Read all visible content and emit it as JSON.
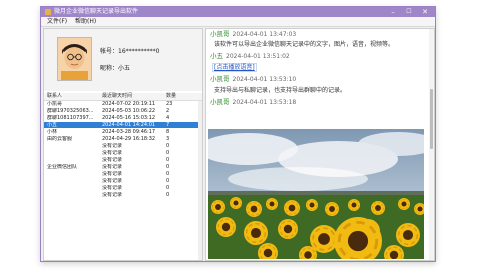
{
  "window": {
    "title": "微月企业微信聊天记录导出软件",
    "controls": {
      "minimize": "–",
      "maximize": "☐",
      "close": "✕"
    }
  },
  "menu": {
    "items": [
      "文件(F)",
      "帮助(H)"
    ]
  },
  "profile": {
    "account_label": "帐号：",
    "account_value": "16**********0",
    "nickname_label": "昵称：",
    "nickname_value": "小五"
  },
  "contacts_table": {
    "columns": [
      "联系人",
      "最近聊天时间",
      "数量"
    ],
    "rows": [
      {
        "name": "小凯哥",
        "time": "2024-07-02 20:19:11",
        "count": "23",
        "selected": false
      },
      {
        "name": "群聊1970325063...",
        "time": "2024-05-03 10:06:22",
        "count": "2",
        "selected": false
      },
      {
        "name": "群聊1081107397...",
        "time": "2024-05-16 15:03:12",
        "count": "4",
        "selected": false
      },
      {
        "name": "小五",
        "time": "2024-04-01 14:24:01",
        "count": "7",
        "selected": true
      },
      {
        "name": "小林",
        "time": "2024-03-28 09:46:17",
        "count": "8",
        "selected": false
      },
      {
        "name": "由的云客服",
        "time": "2024-04-29 16:18:32",
        "count": "3",
        "selected": false
      },
      {
        "name": "",
        "time": "没有记录",
        "count": "0",
        "selected": false
      },
      {
        "name": "",
        "time": "没有记录",
        "count": "0",
        "selected": false
      },
      {
        "name": "",
        "time": "没有记录",
        "count": "0",
        "selected": false
      },
      {
        "name": "企业微信团队",
        "time": "没有记录",
        "count": "0",
        "selected": false
      },
      {
        "name": "",
        "time": "没有记录",
        "count": "0",
        "selected": false
      },
      {
        "name": "",
        "time": "没有记录",
        "count": "0",
        "selected": false
      },
      {
        "name": "",
        "time": "没有记录",
        "count": "0",
        "selected": false
      },
      {
        "name": "",
        "time": "没有记录",
        "count": "0",
        "selected": false
      }
    ]
  },
  "chat": {
    "messages": [
      {
        "sender": "小凯哥",
        "time": "2024-04-01 13:47:03",
        "content": "该软件可以导出企业微信聊天记录中的文字，图片，语音，视频等。"
      },
      {
        "sender": "小五",
        "time": "2024-04-01 13:51:02",
        "content": "[点击播放语音]"
      },
      {
        "sender": "小凯哥",
        "time": "2024-04-01 13:53:10",
        "content": "支持导出与私聊记录，也支持导出群聊中的记录。"
      },
      {
        "sender": "小凯哥",
        "time": "2024-04-01 13:53:18",
        "content": ""
      }
    ]
  }
}
